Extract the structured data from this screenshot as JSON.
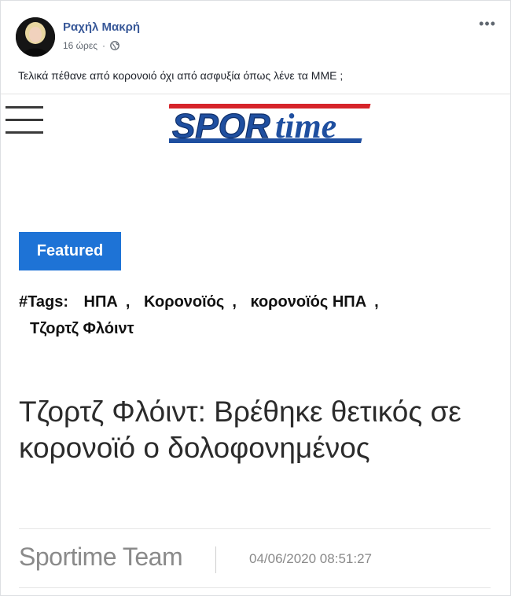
{
  "post": {
    "author": "Ραχήλ Μακρή",
    "time": "16 ώρες",
    "separator": "·",
    "text": "Τελικά πέθανε από κορονοιό όχι από ασφυξία όπως λένε τα ΜΜΕ ;",
    "more_icon": "•••",
    "avatar_icon": "avatar",
    "privacy_icon": "globe-icon"
  },
  "shared": {
    "logo": {
      "part1": "SPOR",
      "part2": "time",
      "colors": {
        "blue": "#1f4fa0",
        "red": "#d6242a"
      }
    },
    "featured_label": "Featured",
    "tags_label": "#Tags:",
    "tags": [
      "ΗΠΑ",
      "Κορονοϊός",
      "κορονοϊός ΗΠΑ",
      "Τζορτζ Φλόιντ"
    ],
    "tag_separator": ",",
    "headline": "Τζορτζ Φλόιντ: Βρέθηκε θετικός σε κορονοϊό ο δολοφονημένος",
    "byline": "Sportime Team",
    "date": "04/06/2020 08:51:27"
  },
  "colors": {
    "author_link": "#385898",
    "featured_bg": "#1e73d6"
  }
}
